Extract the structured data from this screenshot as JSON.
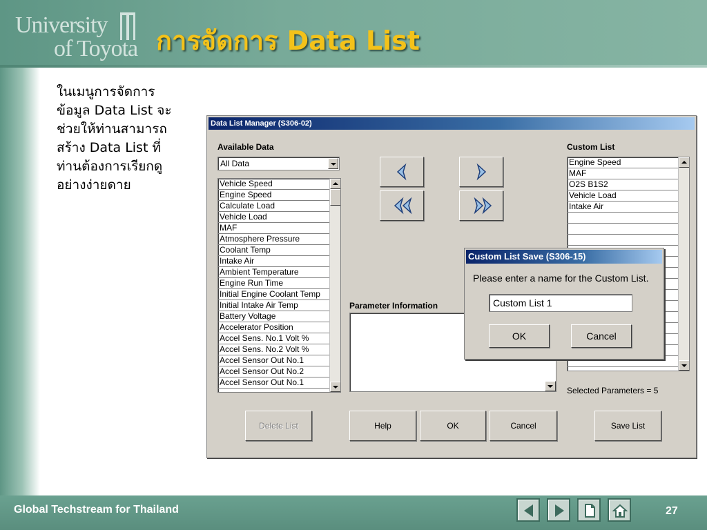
{
  "slide": {
    "logo": {
      "line1": "University",
      "line2": "of Toyota"
    },
    "title": "การจัดการ Data List",
    "body_lines": [
      "ในเมนูการจัดการ",
      "ข้อมูล Data List จะ",
      "ช่วยให้ท่านสามารถ",
      "สร้าง Data List ที่",
      "ท่านต้องการเรียกดู",
      "อย่างง่ายดาย"
    ],
    "footer_text": "Global Techstream for Thailand",
    "page_number": "27",
    "nav_icons": [
      "previous-slide-icon",
      "next-slide-icon",
      "document-icon",
      "home-icon"
    ]
  },
  "dialog": {
    "title": "Data List Manager (S306-02)",
    "available_label": "Available Data",
    "filter_value": "All Data",
    "available_items": [
      "Vehicle Speed",
      "Engine Speed",
      "Calculate Load",
      "Vehicle Load",
      "MAF",
      "Atmosphere Pressure",
      "Coolant Temp",
      "Intake Air",
      "Ambient Temperature",
      "Engine Run Time",
      "Initial Engine Coolant Temp",
      "Initial Intake Air Temp",
      "Battery Voltage",
      "Accelerator Position",
      "Accel Sens. No.1 Volt %",
      "Accel Sens. No.2 Volt %",
      "Accel Sensor Out No.1",
      "Accel Sensor Out No.2",
      "Accel Sensor Out No.1"
    ],
    "custom_label": "Custom List",
    "custom_items": [
      "Engine Speed",
      "MAF",
      "O2S B1S2",
      "Vehicle Load",
      "Intake Air"
    ],
    "custom_empty_rows": 14,
    "param_info_label": "Parameter Information",
    "selected_params": "Selected Parameters = 5",
    "buttons": {
      "delete_list": "Delete List",
      "help": "Help",
      "ok": "OK",
      "cancel": "Cancel",
      "save_list": "Save List"
    }
  },
  "save_popup": {
    "title": "Custom List Save (S306-15)",
    "message": "Please enter a name for the Custom List.",
    "input_value": "Custom List 1",
    "ok": "OK",
    "cancel": "Cancel"
  }
}
